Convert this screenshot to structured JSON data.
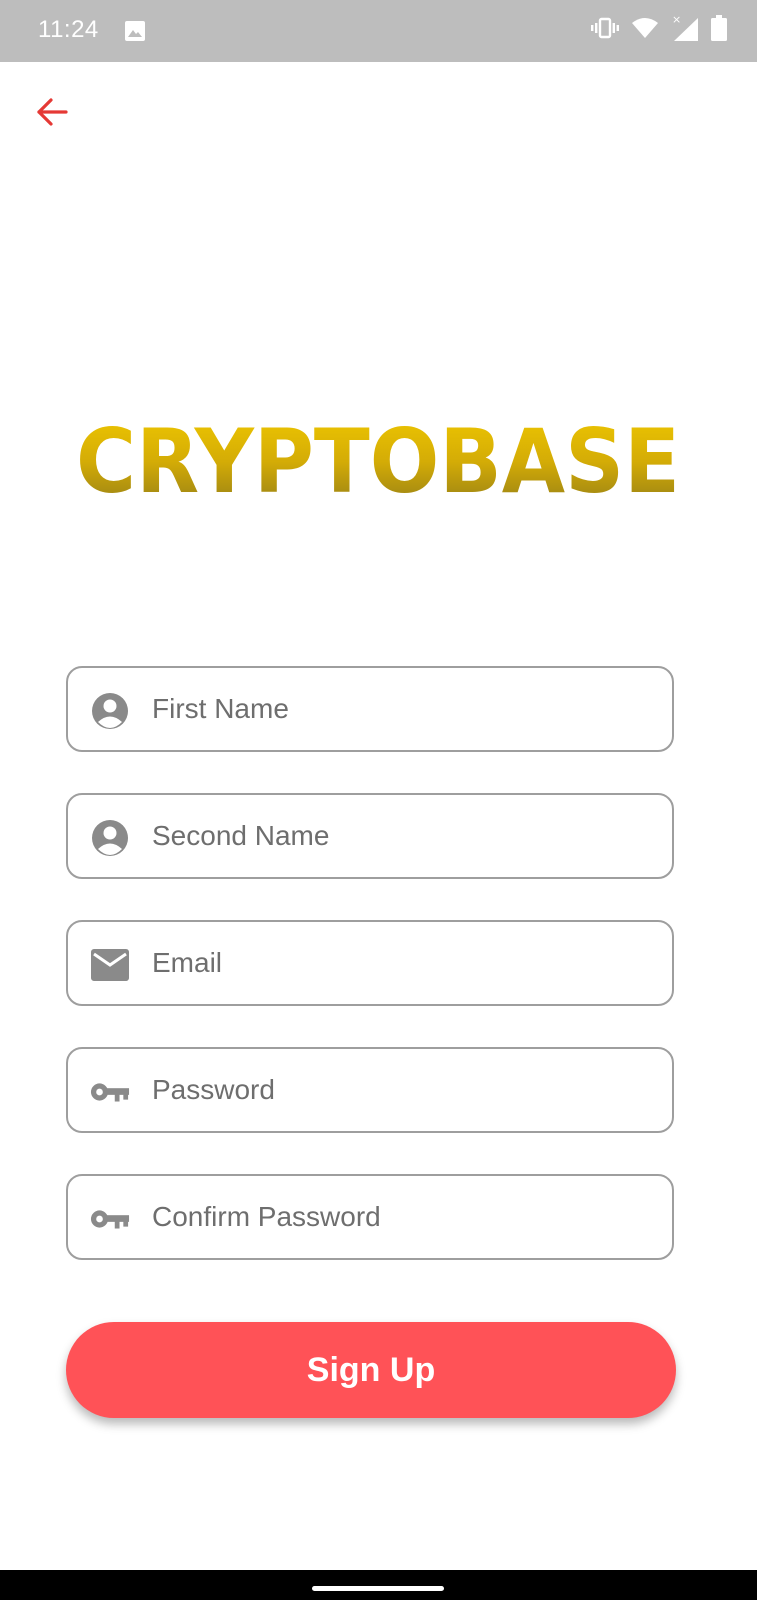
{
  "status_bar": {
    "time": "11:24",
    "icons": [
      "image-icon",
      "vibrate-icon",
      "wifi-icon",
      "signal-icon",
      "battery-icon"
    ]
  },
  "header": {
    "back_icon": "arrow-left-icon",
    "back_color": "#e53935"
  },
  "logo": {
    "text": "CRYPTOBASE",
    "colors": [
      "#f0c800",
      "#8f7a18"
    ]
  },
  "form": {
    "fields": [
      {
        "placeholder": "First Name",
        "icon": "account-circle-icon"
      },
      {
        "placeholder": "Second Name",
        "icon": "account-circle-icon"
      },
      {
        "placeholder": "Email",
        "icon": "mail-icon"
      },
      {
        "placeholder": "Password",
        "icon": "key-icon"
      },
      {
        "placeholder": "Confirm Password",
        "icon": "key-icon"
      }
    ]
  },
  "signup_button": {
    "label": "Sign Up",
    "color": "#ff5257"
  }
}
